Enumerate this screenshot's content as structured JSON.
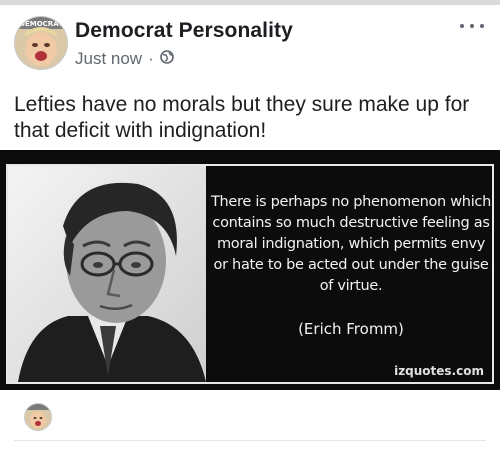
{
  "post": {
    "author": "Democrat Personality",
    "timestamp": "Just now",
    "separator": "·",
    "privacy_icon": "globe-icon",
    "more_icon": "more-options-icon",
    "avatar_badge_text": "DEMOCRAT",
    "text": "Lefties have no morals but they sure make up for that deficit with indignation!"
  },
  "quote_image": {
    "quote": "There is perhaps no phenomenon which contains so much destructive feeling as moral indignation, which permits envy or hate to be acted out under the guise of virtue.",
    "author": "(Erich Fromm)",
    "watermark": "izquotes.com"
  },
  "comment": {
    "avatar_icon": "commenter-avatar"
  },
  "colors": {
    "image_background": "#0c0c0c",
    "meta_text": "#606770",
    "name_text": "#1c1e21"
  }
}
